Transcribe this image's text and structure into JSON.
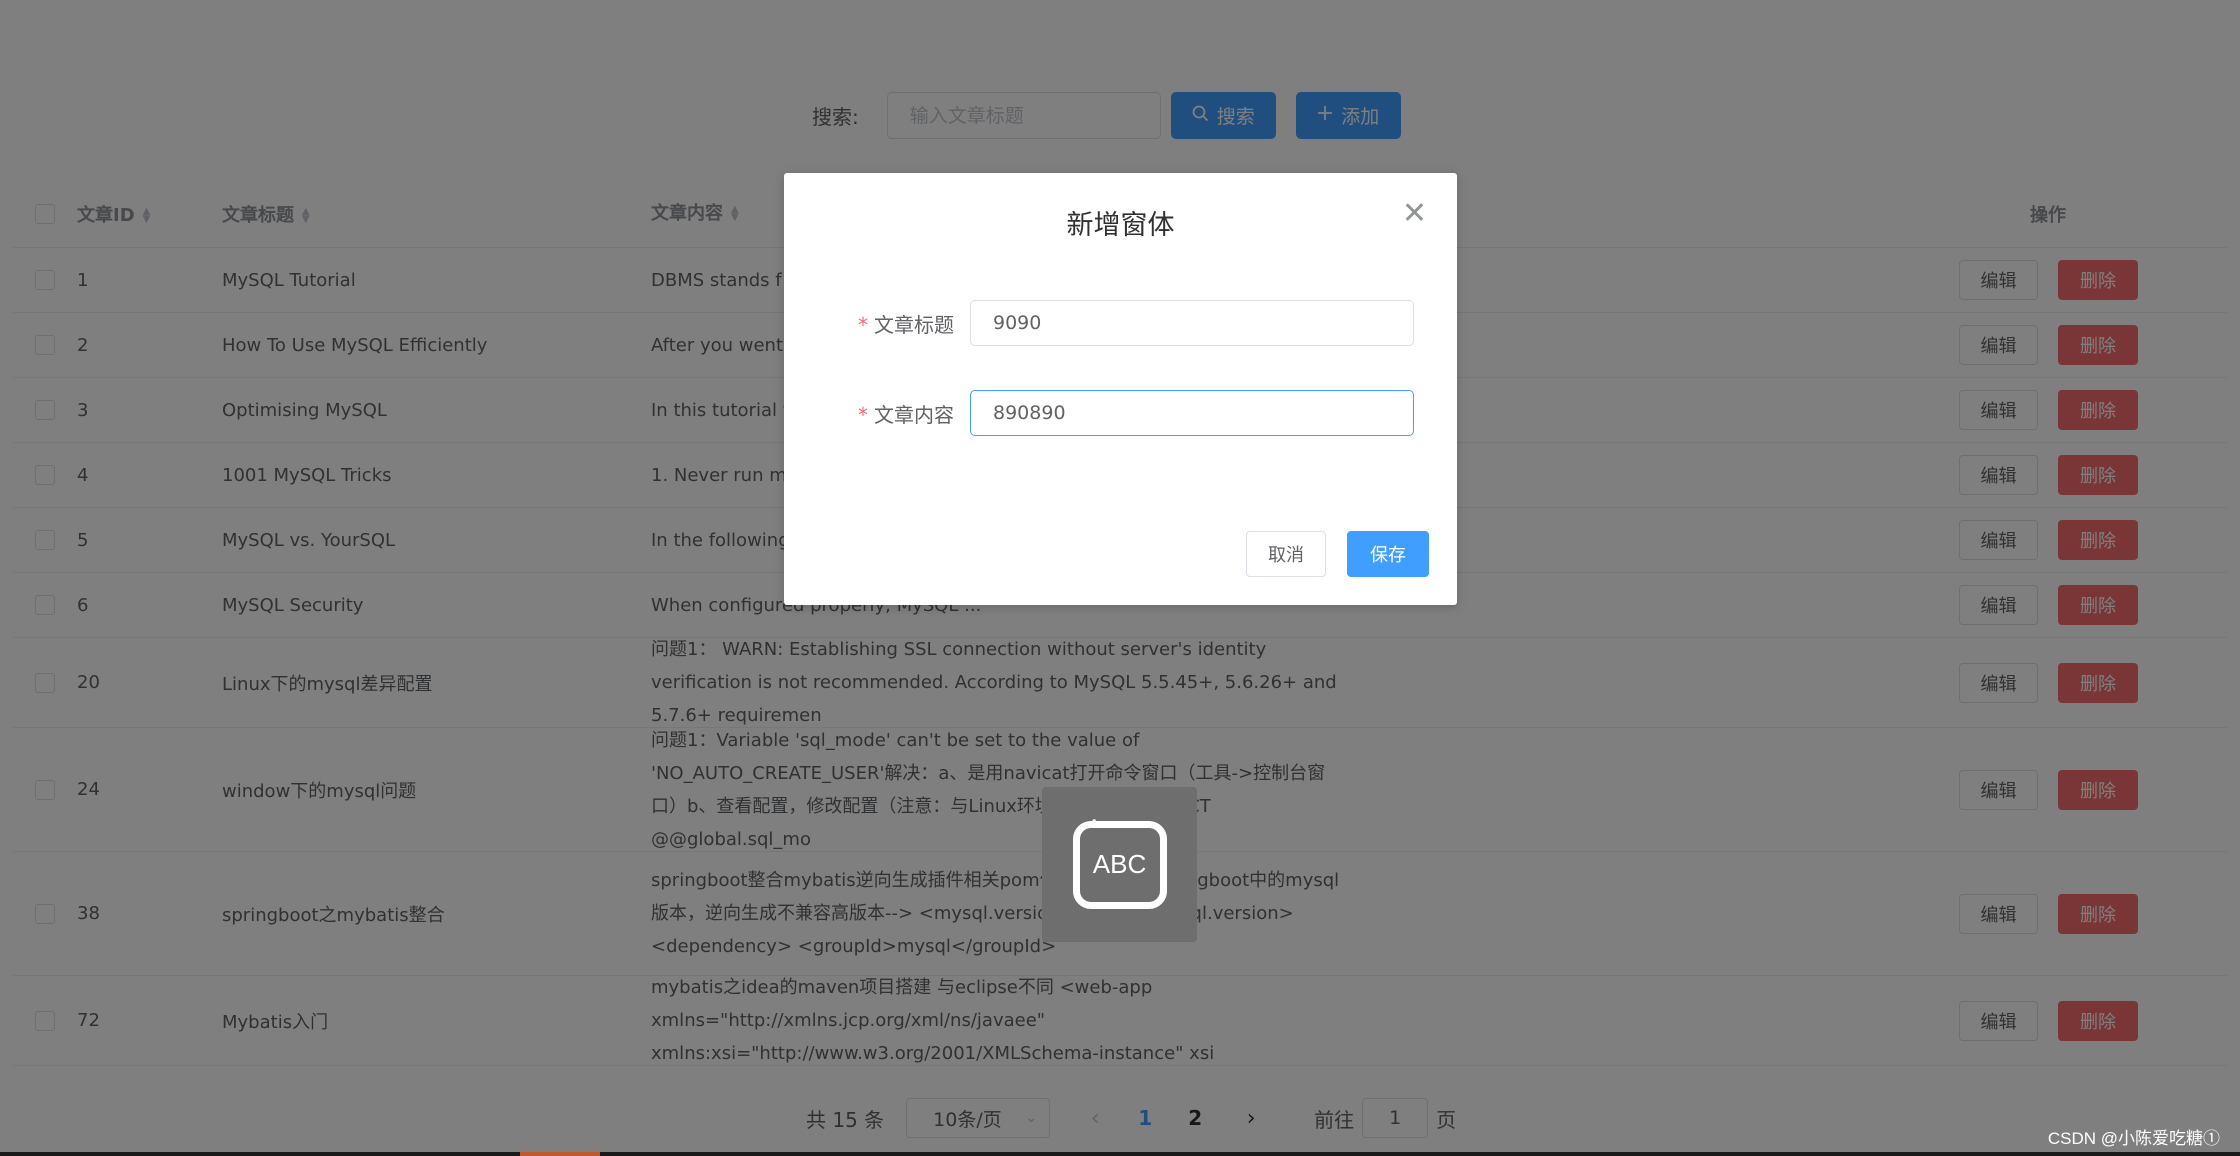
{
  "search": {
    "label": "搜索:",
    "placeholder": "输入文章标题",
    "search_button": "搜索",
    "add_button": "添加"
  },
  "table": {
    "headers": {
      "id": "文章ID",
      "title": "文章标题",
      "content": "文章内容",
      "ops": "操作"
    },
    "edit_label": "编辑",
    "delete_label": "删除",
    "rows": [
      {
        "id": "1",
        "title": "MySQL Tutorial",
        "content": "DBMS stands f"
      },
      {
        "id": "2",
        "title": "How To Use MySQL Efficiently",
        "content": "After you went"
      },
      {
        "id": "3",
        "title": "Optimising MySQL",
        "content": "In this tutorial v"
      },
      {
        "id": "4",
        "title": "1001 MySQL Tricks",
        "content": "1. Never run m"
      },
      {
        "id": "5",
        "title": "MySQL vs. YourSQL",
        "content": "In the following"
      },
      {
        "id": "6",
        "title": "MySQL Security",
        "content": "When configured properly, MySQL ..."
      },
      {
        "id": "20",
        "title": "Linux下的mysql差异配置",
        "content": "问题1： WARN: Establishing SSL connection without server's identity verification is not recommended. According to MySQL 5.5.45+, 5.6.26+ and 5.7.6+ requiremen"
      },
      {
        "id": "24",
        "title": "window下的mysql问题",
        "content": "问题1：Variable 'sql_mode' can't be set to the value of 'NO_AUTO_CREATE_USER'解决：a、是用navicat打开命令窗口（工具->控制台窗口）b、查看配置，修改配置（注意：与Linux环境有所差异）SELECT @@global.sql_mo"
      },
      {
        "id": "38",
        "title": "springboot之mybatis整合",
        "content": "springboot整合mybatis逆向生成插件相关pom依赖<!-- 更改springboot中的mysql版本，逆向生成不兼容高版本--> <mysql.version>5.1.44</mysql.version> <dependency> <groupId>mysql</groupId>"
      },
      {
        "id": "72",
        "title": "Mybatis入门",
        "content": "mybatis之idea的maven项目搭建 与eclipse不同 <web-app xmlns=\"http://xmlns.jcp.org/xml/ns/javaee\" xmlns:xsi=\"http://www.w3.org/2001/XMLSchema-instance\" xsi"
      }
    ]
  },
  "pagination": {
    "total": "共 15 条",
    "page_size": "10条/页",
    "pages": [
      "1",
      "2"
    ],
    "goto_prefix": "前往",
    "goto_value": "1",
    "goto_suffix": "页"
  },
  "dialog": {
    "title": "新增窗体",
    "fields": [
      {
        "label": "文章标题",
        "value": "9090"
      },
      {
        "label": "文章内容",
        "value": "890890"
      }
    ],
    "cancel": "取消",
    "save": "保存"
  },
  "ime": {
    "text": "ABC"
  },
  "watermark": "CSDN @小陈爱吃糖①",
  "colors": {
    "primary": "#409eff",
    "danger": "#f56c6c",
    "mask": "rgba(0,0,0,0.5)"
  }
}
